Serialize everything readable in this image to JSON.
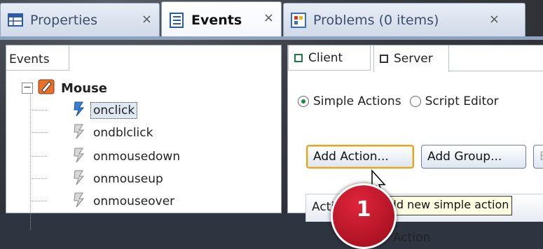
{
  "tabs": [
    {
      "label": "Properties",
      "close": "×",
      "icon": "properties-table-icon",
      "active": false
    },
    {
      "label": "Events",
      "close": "×",
      "icon": "events-list-icon",
      "active": true
    },
    {
      "label": "Problems (0 items)",
      "close": "×",
      "icon": "problems-icon",
      "active": false
    }
  ],
  "left_panel": {
    "header": "Events",
    "group": {
      "label": "Mouse",
      "expander": "⊟",
      "icon": "mouse-group-icon"
    },
    "events": [
      {
        "label": "onclick",
        "selected": true
      },
      {
        "label": "ondblclick",
        "selected": false
      },
      {
        "label": "onmousedown",
        "selected": false
      },
      {
        "label": "onmouseup",
        "selected": false
      },
      {
        "label": "onmouseover",
        "selected": false
      }
    ]
  },
  "right_panel": {
    "tabs": [
      {
        "label": "Client",
        "active": false
      },
      {
        "label": "Server",
        "active": true
      }
    ],
    "mode_options": [
      {
        "label": "Simple Actions",
        "selected": true
      },
      {
        "label": "Script Editor",
        "selected": false
      }
    ],
    "buttons": {
      "add_action": "Add Action...",
      "add_group": "Add Group...",
      "partial": "E"
    },
    "table_header": "Acti",
    "table_row_partial": "Action"
  },
  "tooltip": "Add new simple action",
  "step_badge": "1",
  "colors": {
    "accent_green": "#1a8a3a",
    "focus_orange": "#e8a320",
    "badge_red": "#c8182e",
    "tooltip_bg": "#ffffe1"
  }
}
